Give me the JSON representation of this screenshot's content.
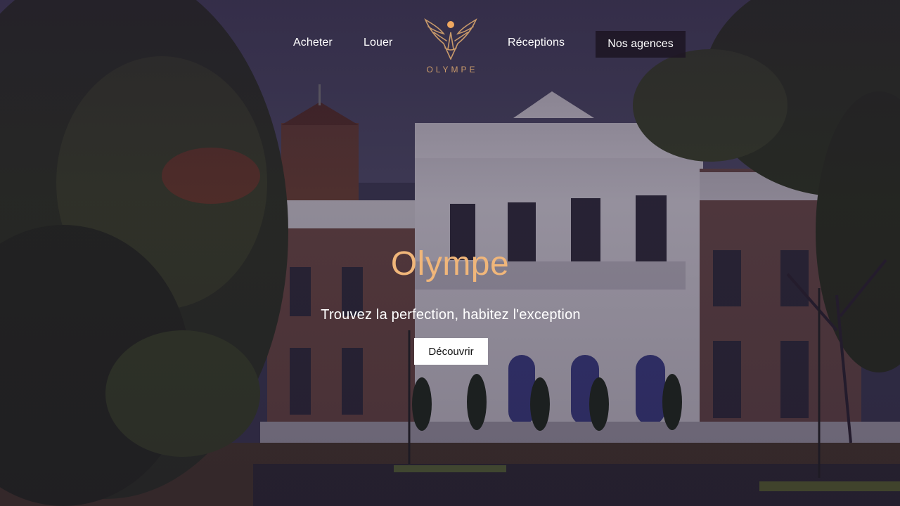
{
  "nav": {
    "links": [
      {
        "label": "Acheter"
      },
      {
        "label": "Louer"
      },
      {
        "label": "Réceptions"
      }
    ],
    "agencies_label": "Nos agences"
  },
  "logo": {
    "text": "OLYMPE",
    "icon": "winged-emblem-icon",
    "color": "#c99a6a"
  },
  "hero": {
    "title": "Olympe",
    "subtitle": "Trouvez la perfection, habitez l'exception",
    "cta_label": "Découvrir",
    "title_color": "#f0b67a",
    "background": "photo of a white classical mansion beside a pond framed by trees"
  }
}
